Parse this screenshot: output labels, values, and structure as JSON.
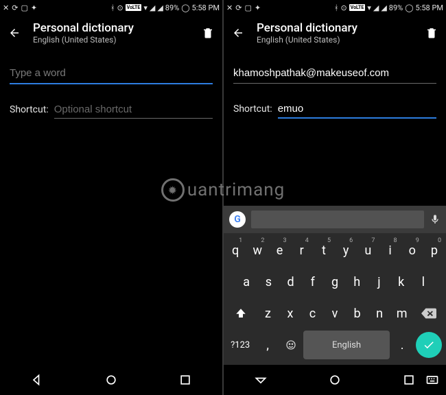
{
  "status": {
    "battery": "89%",
    "time": "5:58 PM",
    "volte": "VoLTE"
  },
  "left": {
    "title": "Personal dictionary",
    "subtitle": "English (United States)",
    "word_placeholder": "Type a word",
    "word_value": "",
    "shortcut_label": "Shortcut:",
    "shortcut_placeholder": "Optional shortcut",
    "shortcut_value": ""
  },
  "right": {
    "title": "Personal dictionary",
    "subtitle": "English (United States)",
    "word_value": "khamoshpathak@makeuseof.com",
    "shortcut_label": "Shortcut:",
    "shortcut_value": "emuo"
  },
  "keyboard": {
    "row1": [
      {
        "k": "q",
        "h": "1"
      },
      {
        "k": "w",
        "h": "2"
      },
      {
        "k": "e",
        "h": "3"
      },
      {
        "k": "r",
        "h": "4"
      },
      {
        "k": "t",
        "h": "5"
      },
      {
        "k": "y",
        "h": "6"
      },
      {
        "k": "u",
        "h": "7"
      },
      {
        "k": "i",
        "h": "8"
      },
      {
        "k": "o",
        "h": "9"
      },
      {
        "k": "p",
        "h": "0"
      }
    ],
    "row2": [
      "a",
      "s",
      "d",
      "f",
      "g",
      "h",
      "j",
      "k",
      "l"
    ],
    "row3": [
      "z",
      "x",
      "c",
      "v",
      "b",
      "n",
      "m"
    ],
    "sym": "?123",
    "space": "English",
    "comma": ",",
    "period": "."
  },
  "watermark": "uantrimang"
}
